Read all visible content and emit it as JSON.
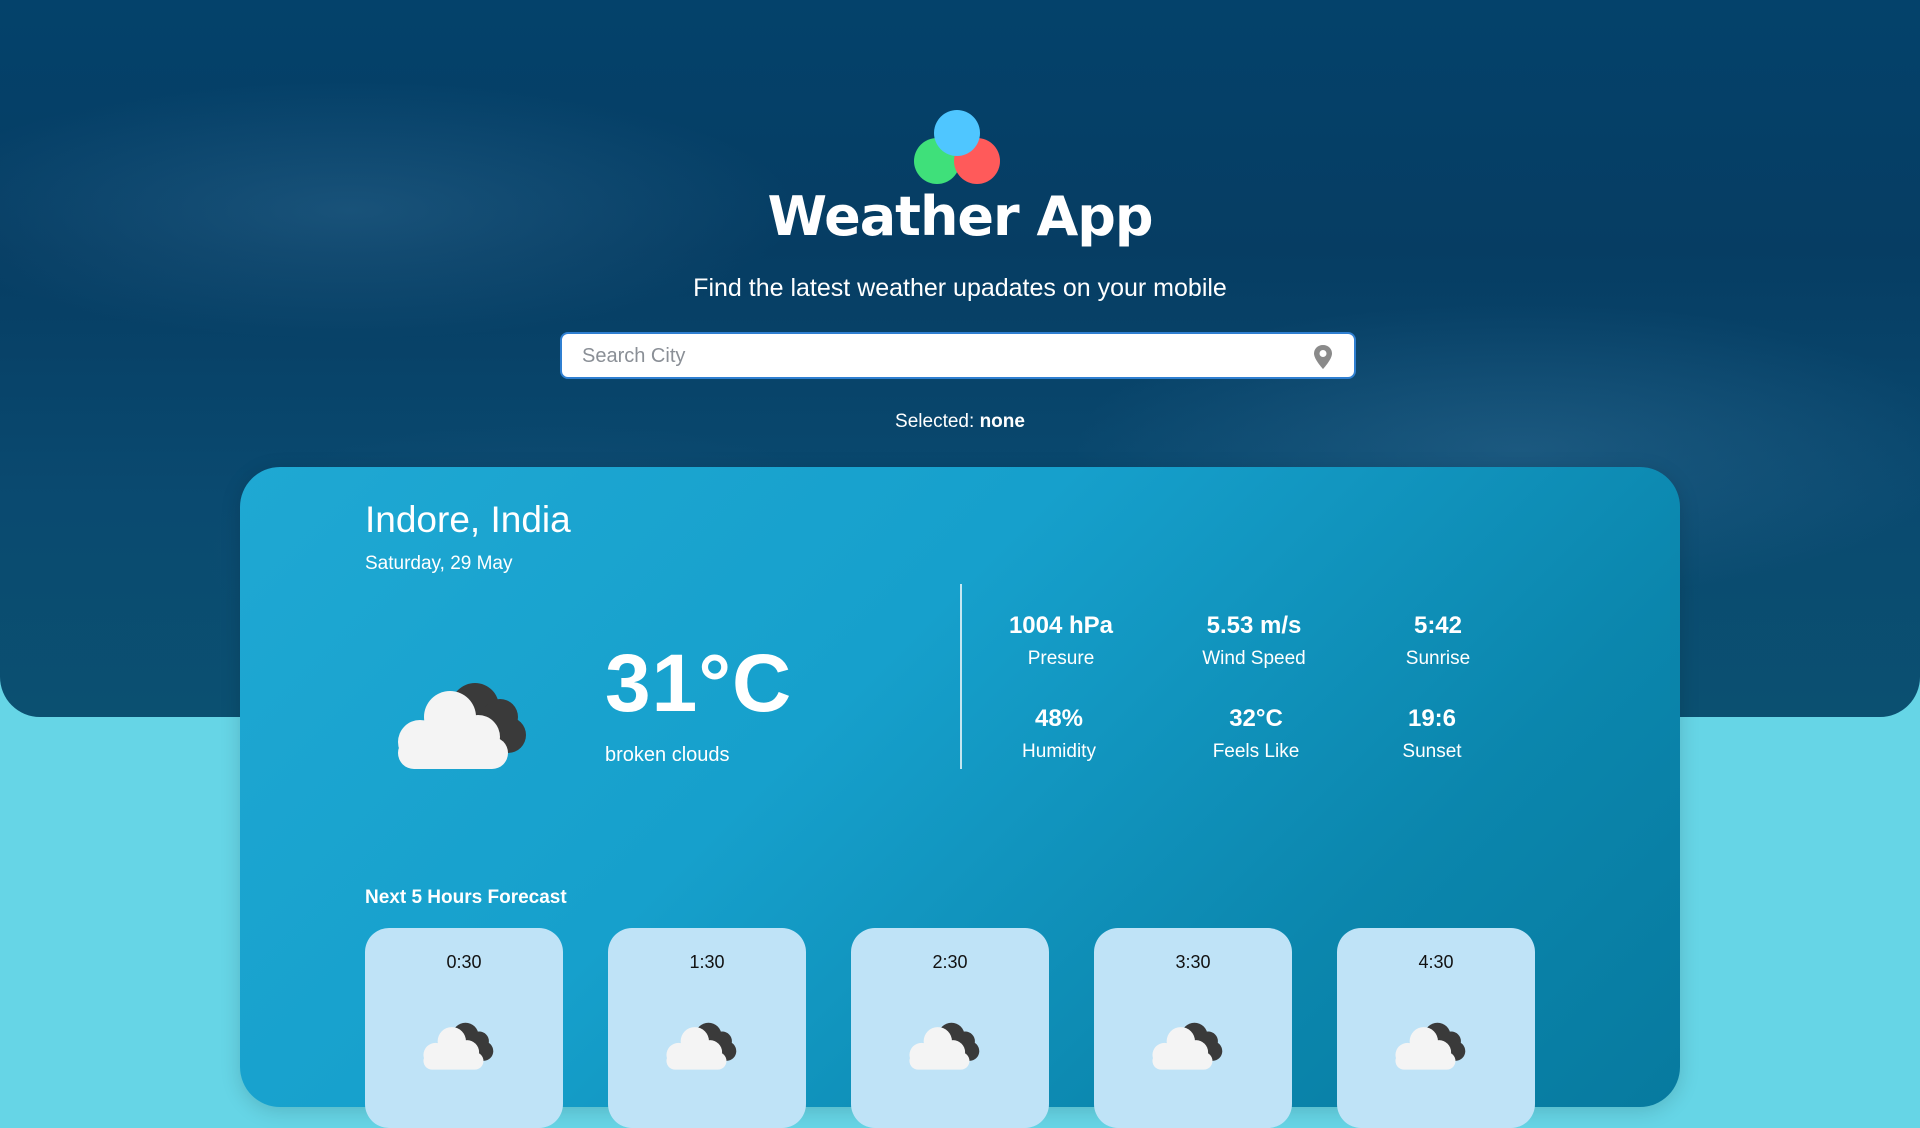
{
  "app": {
    "title": "Weather App",
    "subtitle": "Find the latest weather upadates on your mobile",
    "logo_colors": [
      "#3fe07a",
      "#ff5a5a",
      "#4fc6ff"
    ]
  },
  "search": {
    "placeholder": "Search City",
    "value": "",
    "icon": "map-pin-icon"
  },
  "selected": {
    "label": "Selected:",
    "value": "none"
  },
  "current": {
    "city": "Indore, India",
    "date": "Saturday, 29 May",
    "temperature": "31°C",
    "description": "broken clouds",
    "icon": "broken-clouds-icon"
  },
  "stats": [
    {
      "value": "1004 hPa",
      "label": "Presure"
    },
    {
      "value": "5.53 m/s",
      "label": "Wind Speed"
    },
    {
      "value": "5:42",
      "label": "Sunrise"
    },
    {
      "value": "48%",
      "label": "Humidity"
    },
    {
      "value": "32°C",
      "label": "Feels Like"
    },
    {
      "value": "19:6",
      "label": "Sunset"
    }
  ],
  "forecast": {
    "title": "Next 5 Hours Forecast",
    "items": [
      {
        "time": "0:30",
        "icon": "broken-clouds-icon"
      },
      {
        "time": "1:30",
        "icon": "broken-clouds-icon"
      },
      {
        "time": "2:30",
        "icon": "broken-clouds-icon"
      },
      {
        "time": "3:30",
        "icon": "broken-clouds-icon"
      },
      {
        "time": "4:30",
        "icon": "broken-clouds-icon"
      }
    ]
  },
  "colors": {
    "hero_bg": "#04426b",
    "page_bg": "#66d5e6",
    "card_bg": "#16a0cc",
    "forecast_card_bg": "#bfe3f7",
    "search_border": "#2f7fd1"
  }
}
